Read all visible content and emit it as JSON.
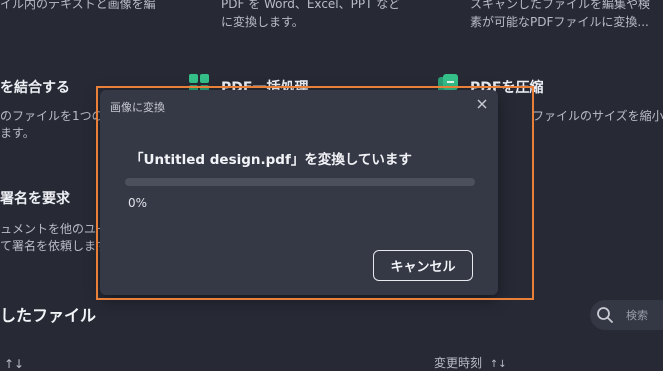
{
  "background": {
    "row1": {
      "col1_desc": "イル内のテキストと画像を編",
      "col2_desc_line1": "PDF を Word、Excel、PPT など",
      "col2_desc_line2": "に変換します。",
      "col3_desc_line1": "スキャンしたファイルを編集や検",
      "col3_desc_line2": "素が可能なPDFファイルに変換..."
    },
    "features": [
      {
        "title": "を結合する",
        "desc_line1": "のファイルを1つの",
        "desc_line2": "ます。"
      },
      {
        "title": "PDF一括処理"
      },
      {
        "title": "PDFを圧縮",
        "desc_line1": "ファイルのサイズを縮小しま"
      }
    ],
    "signature": {
      "title": "署名を要求",
      "desc_line1": "ュメントを他のユー",
      "desc_line2": "て署名を依頼します"
    },
    "recent_files_title": "したファイル",
    "search_placeholder": "検索",
    "column_sort_glyph": "↑↓",
    "modified_label": "変更時刻"
  },
  "dialog": {
    "title": "画像に変換",
    "message": "「Untitled design.pdf」を変換しています",
    "progress_percent_label": "0%",
    "progress_fraction": 0,
    "cancel_label": "キャンセル"
  },
  "colors": {
    "highlight_border": "#e8803a",
    "icon_green": "#35c08a",
    "dialog_bg": "#353845",
    "page_bg": "#272a35"
  },
  "icons": {
    "close": "close-icon",
    "search": "search-icon",
    "batch": "batch-pdf-icon",
    "compress": "compress-pdf-icon"
  }
}
